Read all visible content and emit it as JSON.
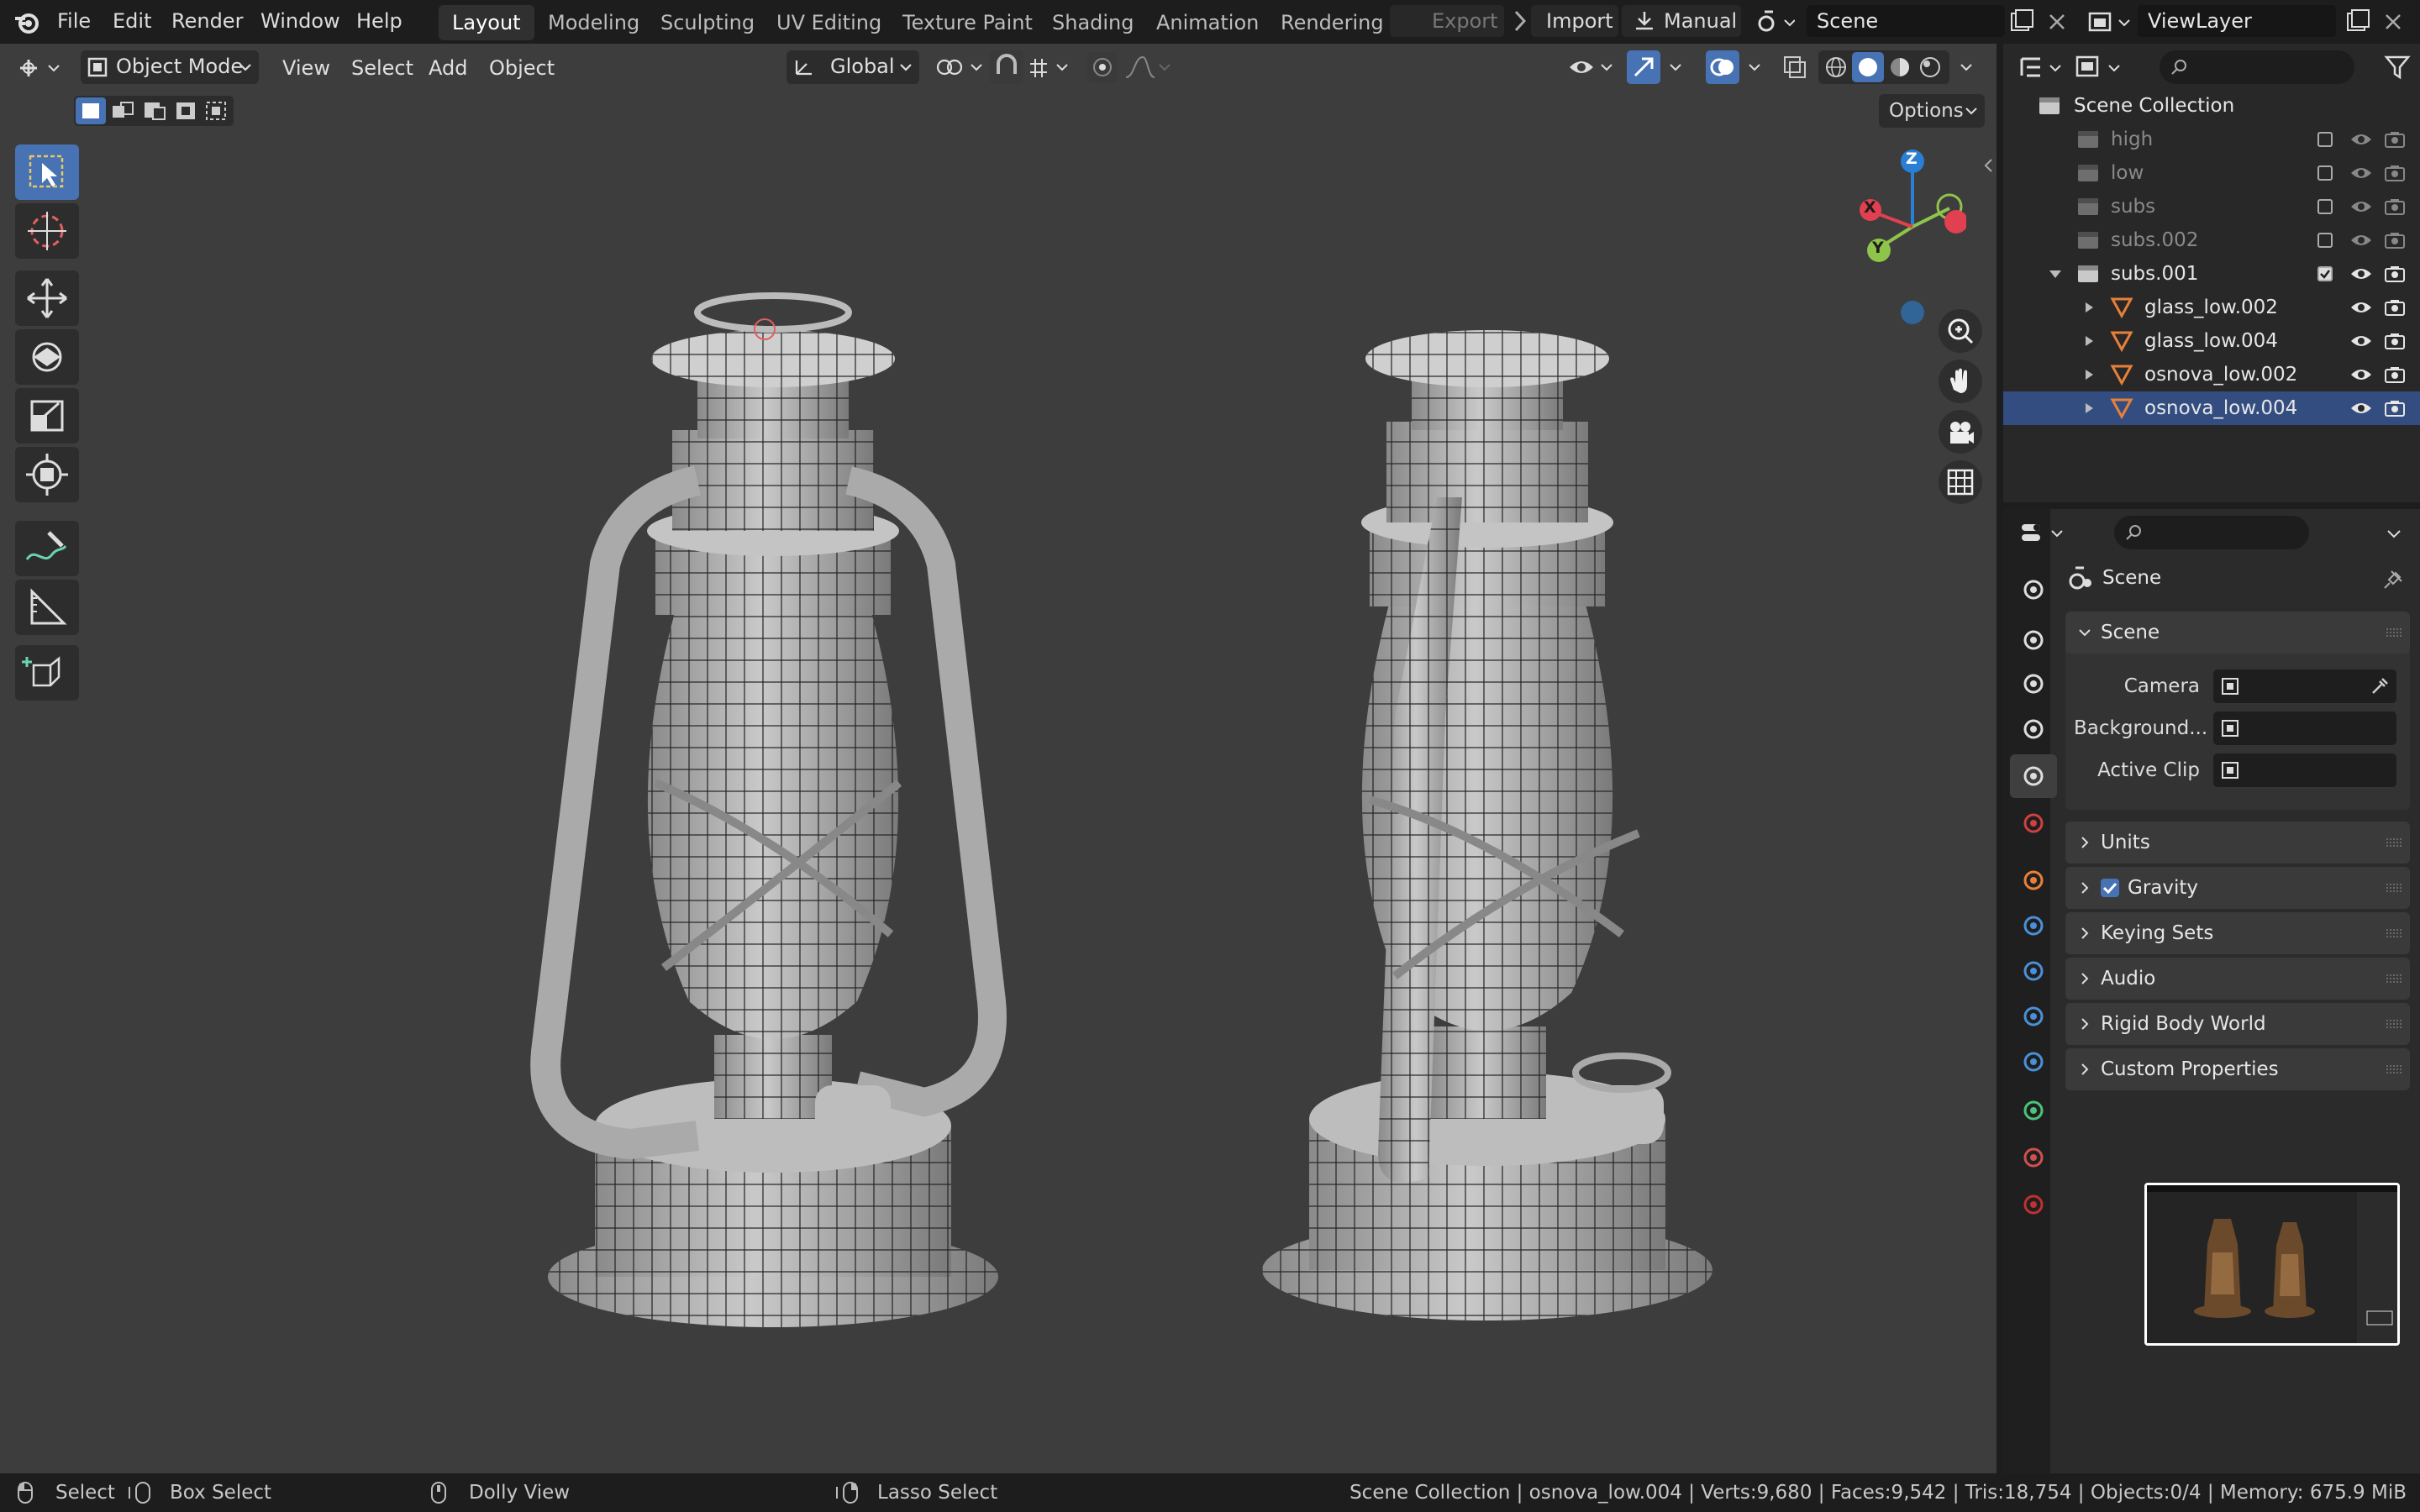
{
  "menu": [
    "File",
    "Edit",
    "Render",
    "Window",
    "Help"
  ],
  "workspaces": [
    "Layout",
    "Modeling",
    "Sculpting",
    "UV Editing",
    "Texture Paint",
    "Shading",
    "Animation",
    "Rendering"
  ],
  "active_workspace": "Layout",
  "top_buttons": {
    "export": "Export",
    "import": "Import",
    "manual": "Manual"
  },
  "scene_name": "Scene",
  "view_layer": "ViewLayer",
  "viewport_header": {
    "mode": "Object Mode",
    "menus": [
      "View",
      "Select",
      "Add",
      "Object"
    ],
    "orientation": "Global",
    "options": "Options"
  },
  "gizmo_axes": {
    "z": "Z",
    "y": "Y",
    "x": "X"
  },
  "outliner": {
    "root": "Scene Collection",
    "rows": [
      {
        "name": "high",
        "type": "collection",
        "enabled": false
      },
      {
        "name": "low",
        "type": "collection",
        "enabled": false
      },
      {
        "name": "subs",
        "type": "collection",
        "enabled": false
      },
      {
        "name": "subs.002",
        "type": "collection",
        "enabled": false
      },
      {
        "name": "subs.001",
        "type": "collection",
        "enabled": true
      },
      {
        "name": "glass_low.002",
        "type": "mesh"
      },
      {
        "name": "glass_low.004",
        "type": "mesh"
      },
      {
        "name": "osnova_low.002",
        "type": "mesh"
      },
      {
        "name": "osnova_low.004",
        "type": "mesh"
      }
    ]
  },
  "properties": {
    "context": "Scene",
    "section": "Scene",
    "fields": [
      "Camera",
      "Background...",
      "Active Clip"
    ],
    "panels": [
      "Units",
      "Gravity",
      "Keying Sets",
      "Audio",
      "Rigid Body World",
      "Custom Properties"
    ],
    "gravity_checked": true
  },
  "statusbar": {
    "left": [
      "Select",
      "Box Select",
      "Dolly View",
      "Lasso Select"
    ],
    "right": "Scene Collection | osnova_low.004 | Verts:9,680 | Faces:9,542 | Tris:18,754 | Objects:0/4 | Memory: 675.9 MiB"
  },
  "colors": {
    "accent": "#4772b3",
    "selection": "#334d80",
    "viewport_bg": "#3d3d3d",
    "mesh_orange": "#e8803a"
  }
}
